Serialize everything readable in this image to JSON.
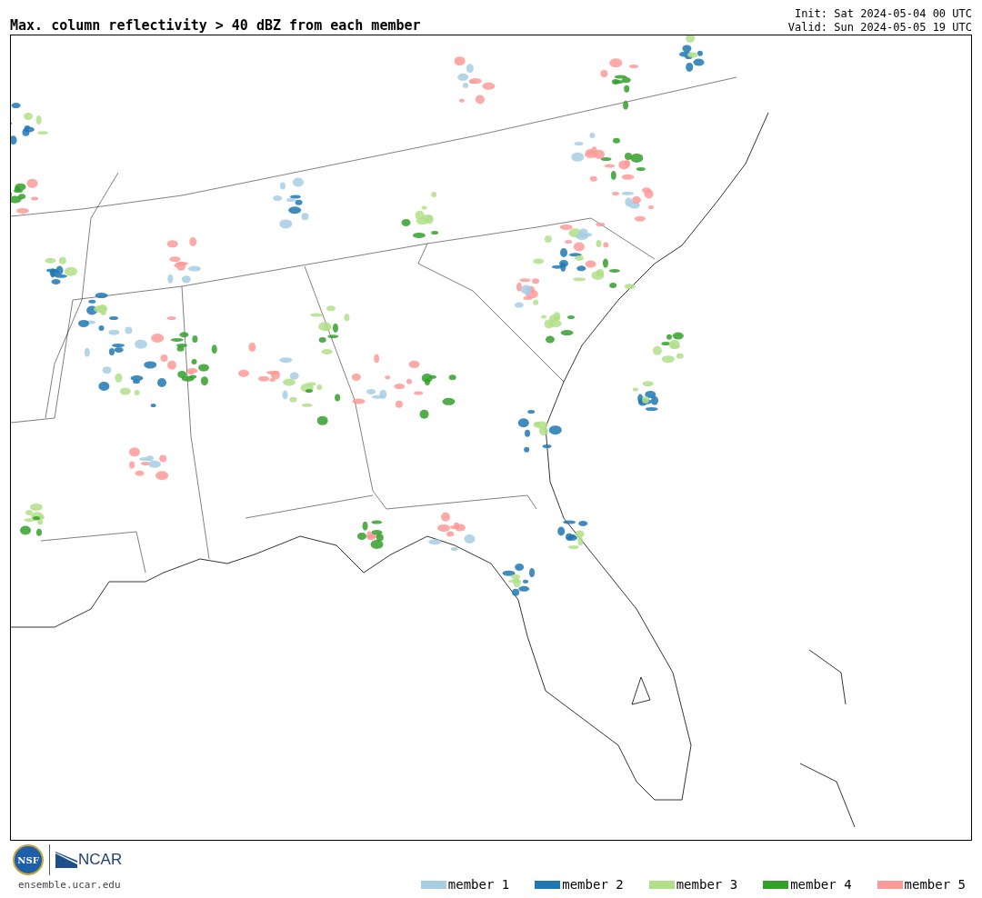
{
  "title": "Max. column reflectivity > 40 dBZ from each member",
  "init": "Init: Sat 2024-05-04 00 UTC",
  "valid": "Valid: Sun 2024-05-05 19 UTC",
  "logos": {
    "nsf": "NSF",
    "ncar": "NCAR"
  },
  "website": "ensemble.ucar.edu",
  "legend": [
    {
      "label": "member 1",
      "color": "#a6cee3"
    },
    {
      "label": "member 2",
      "color": "#1f78b4"
    },
    {
      "label": "member 3",
      "color": "#b2df8a"
    },
    {
      "label": "member 4",
      "color": "#33a02c"
    },
    {
      "label": "member 5",
      "color": "#fb9a99"
    }
  ]
}
